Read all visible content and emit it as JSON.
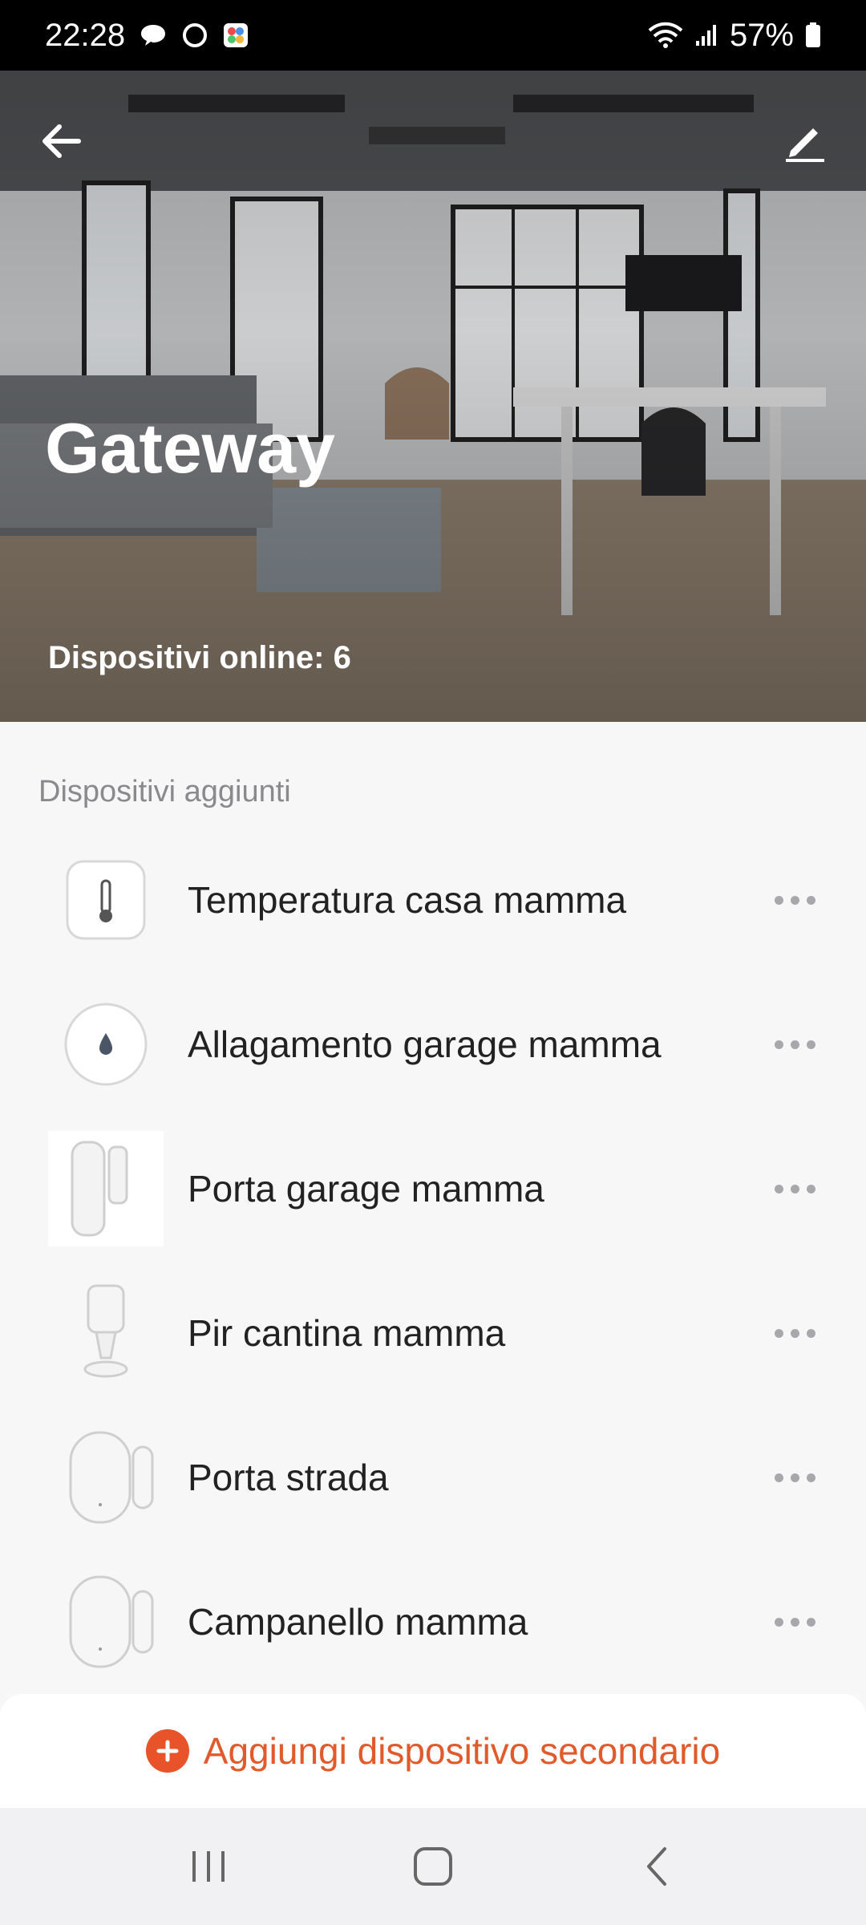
{
  "status_bar": {
    "time": "22:28",
    "battery": "57%",
    "icons": [
      "chat-icon",
      "circle-notification-icon",
      "photos-icon",
      "wifi-icon",
      "signal-icon",
      "battery-icon"
    ]
  },
  "header": {
    "title": "Gateway",
    "online_label": "Dispositivi online: 6",
    "back_icon": "back-arrow-icon",
    "edit_icon": "pencil-icon"
  },
  "section": {
    "title": "Dispositivi aggiunti"
  },
  "devices": [
    {
      "name": "Temperatura casa mamma",
      "icon": "thermometer-sensor-icon"
    },
    {
      "name": "Allagamento garage mamma",
      "icon": "water-leak-sensor-icon"
    },
    {
      "name": "Porta garage mamma",
      "icon": "door-sensor-icon"
    },
    {
      "name": "Pir cantina mamma",
      "icon": "motion-sensor-icon"
    },
    {
      "name": "Porta strada",
      "icon": "door-window-sensor-icon"
    },
    {
      "name": "Campanello mamma",
      "icon": "door-window-sensor-icon"
    }
  ],
  "add_button": {
    "label": "Aggiungi dispositivo secondario",
    "color": "#e8532a"
  },
  "nav": {
    "icons": [
      "recent-apps-icon",
      "home-icon",
      "back-icon"
    ]
  }
}
